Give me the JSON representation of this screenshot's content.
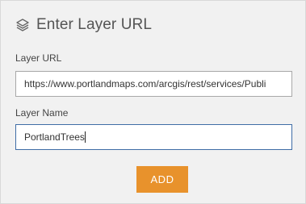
{
  "header": {
    "icon": "layers-icon",
    "title": "Enter Layer URL"
  },
  "layer_url": {
    "label": "Layer URL",
    "value": "https://www.portlandmaps.com/arcgis/rest/services/Publi"
  },
  "layer_name": {
    "label": "Layer Name",
    "value": "PortlandTrees"
  },
  "add_button": {
    "label": "ADD",
    "color": "#e8922c"
  }
}
